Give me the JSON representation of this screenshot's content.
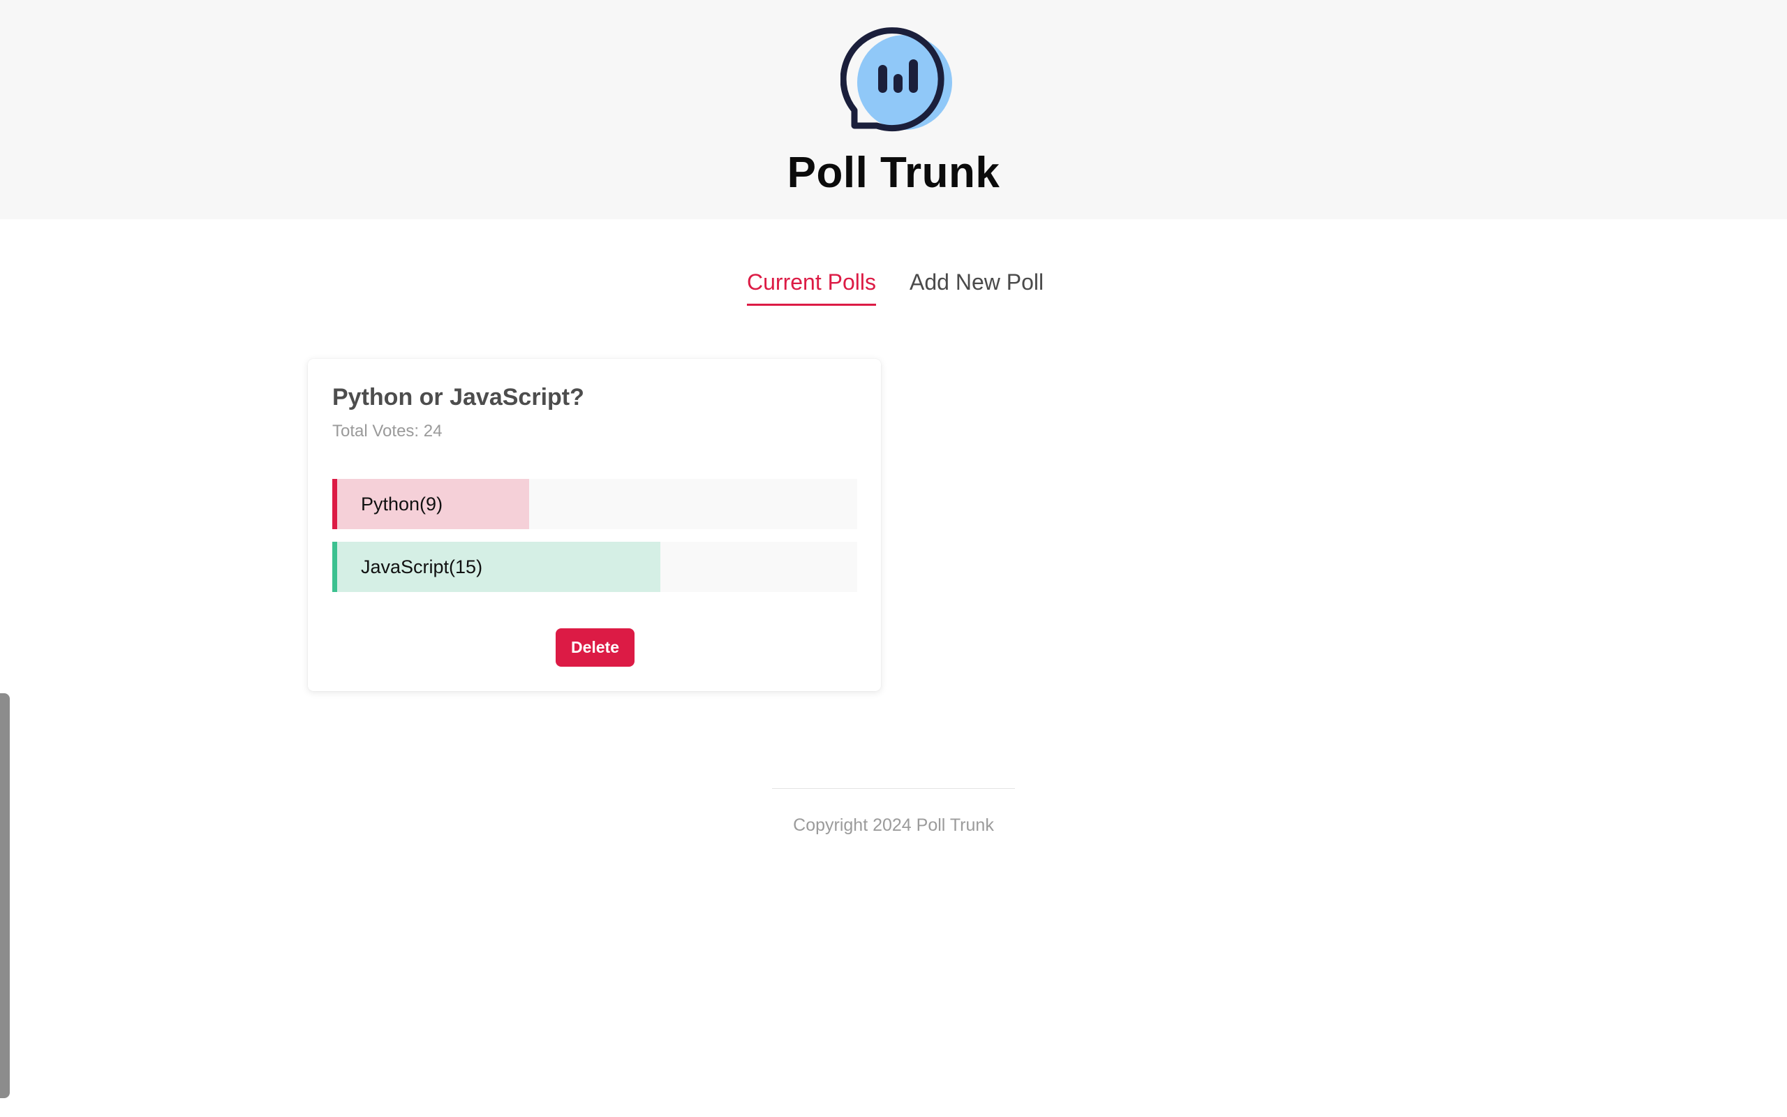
{
  "header": {
    "logo_icon": "chat-bar-chart-icon",
    "title": "Poll Trunk"
  },
  "tabs": [
    {
      "label": "Current Polls",
      "active": true
    },
    {
      "label": "Add New Poll",
      "active": false
    }
  ],
  "poll": {
    "question": "Python or JavaScript?",
    "total_votes_label": "Total Votes: 24",
    "total_votes": 24,
    "options": [
      {
        "label": "Python(9)",
        "name": "Python",
        "votes": 9,
        "share": 0.375,
        "fill_color": "#f5d0d8",
        "accent_color": "#dc1b45"
      },
      {
        "label": "JavaScript(15)",
        "name": "JavaScript",
        "votes": 15,
        "share": 0.625,
        "fill_color": "#d5efe5",
        "accent_color": "#3cc190"
      }
    ],
    "delete_label": "Delete"
  },
  "footer": {
    "copyright": "Copyright 2024 Poll Trunk"
  },
  "colors": {
    "accent": "#dc1b45",
    "header_bg": "#f7f7f7",
    "logo_bubble": "#90c8f8",
    "logo_stroke": "#1b1f3b"
  }
}
